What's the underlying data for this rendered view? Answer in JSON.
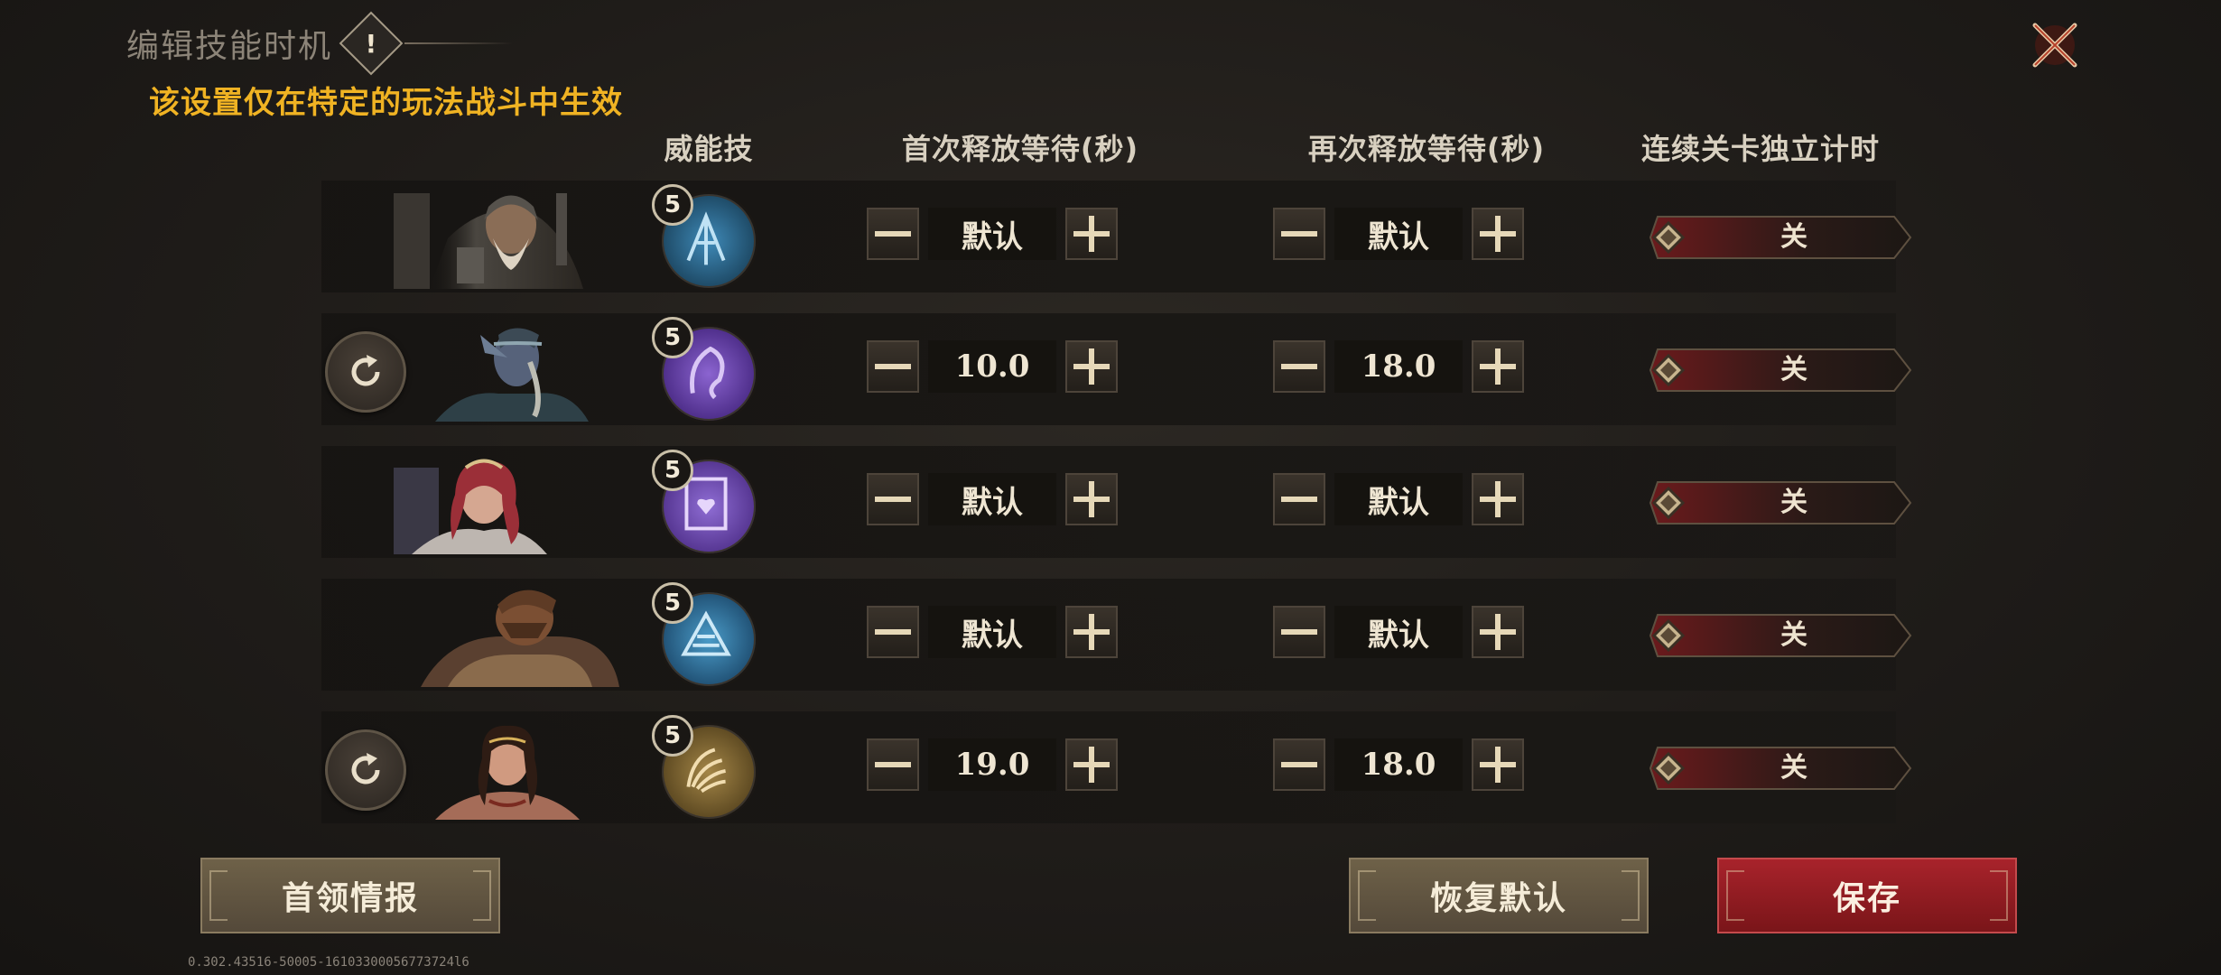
{
  "title": "编辑技能时机",
  "warning_glyph": "!",
  "subtitle": "该设置仅在特定的玩法战斗中生效",
  "headers": {
    "skill": "威能技",
    "first_wait": "首次释放等待(秒)",
    "second_wait": "再次释放等待(秒)",
    "independent_timer": "连续关卡独立计时"
  },
  "rows": [
    {
      "level": "5",
      "first": "默认",
      "second": "默认",
      "toggle": "关",
      "reset": false,
      "skill_color": "#2d6f96"
    },
    {
      "level": "5",
      "first": "10.0",
      "second": "18.0",
      "toggle": "关",
      "reset": true,
      "skill_color": "#5e3fa0"
    },
    {
      "level": "5",
      "first": "默认",
      "second": "默认",
      "toggle": "关",
      "reset": false,
      "skill_color": "#5e3fa0"
    },
    {
      "level": "5",
      "first": "默认",
      "second": "默认",
      "toggle": "关",
      "reset": false,
      "skill_color": "#2d6f96"
    },
    {
      "level": "5",
      "first": "19.0",
      "second": "18.0",
      "toggle": "关",
      "reset": true,
      "skill_color": "#8a6a2e"
    }
  ],
  "buttons": {
    "boss_info": "首领情报",
    "restore_default": "恢复默认",
    "save": "保存"
  },
  "version": "0.302.43516-50005-16103300056773724l6",
  "colors": {
    "accent_yellow": "#f0b323",
    "save_red": "#a8232b",
    "button_brown": "#6e6148"
  }
}
